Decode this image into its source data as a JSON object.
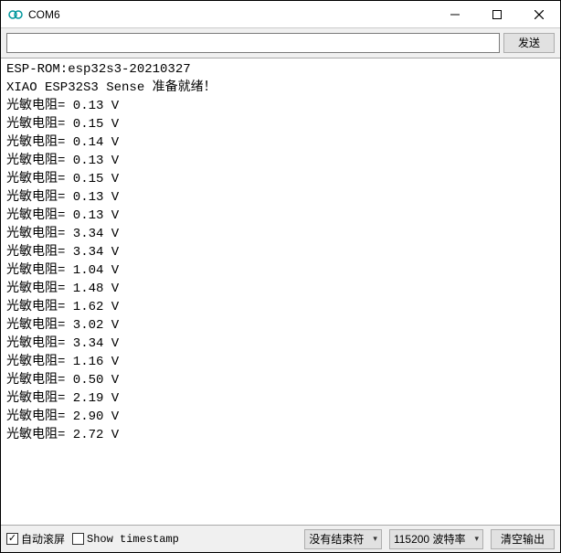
{
  "window": {
    "title": "COM6"
  },
  "toolbar": {
    "input_value": "",
    "send_label": "发送"
  },
  "console": {
    "header_lines": [
      "ESP-ROM:esp32s3-20210327",
      "XIAO ESP32S3 Sense 准备就绪！"
    ],
    "reading_label": "光敏电阻=",
    "reading_unit": "V",
    "readings": [
      "0.13",
      "0.15",
      "0.14",
      "0.13",
      "0.15",
      "0.13",
      "0.13",
      "3.34",
      "3.34",
      "1.04",
      "1.48",
      "1.62",
      "3.02",
      "3.34",
      "1.16",
      "0.50",
      "2.19",
      "2.90",
      "2.72"
    ]
  },
  "statusbar": {
    "autoscroll_label": "自动滚屏",
    "autoscroll_checked": true,
    "timestamp_label": "Show timestamp",
    "timestamp_checked": false,
    "line_ending_selected": "没有结束符",
    "baud_selected": "115200 波特率",
    "clear_label": "清空输出"
  }
}
